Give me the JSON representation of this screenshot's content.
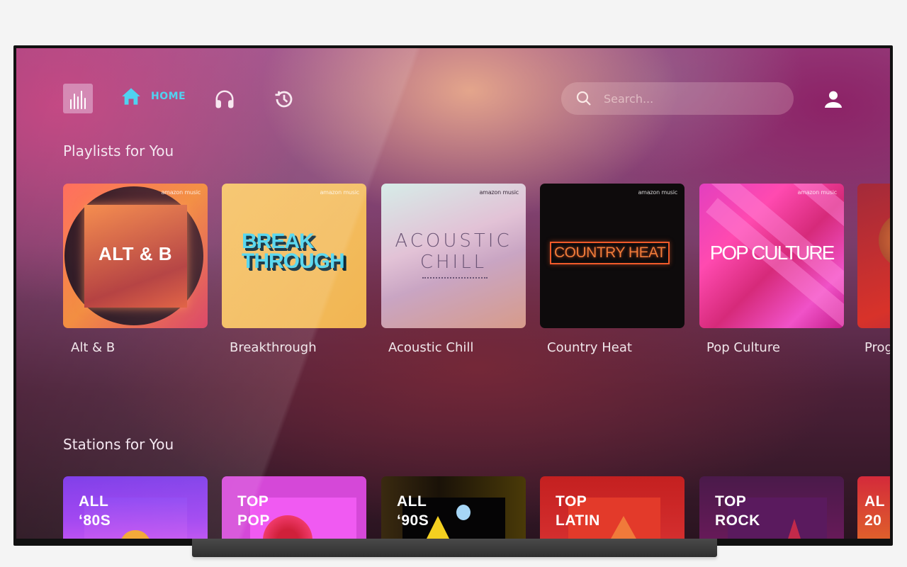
{
  "app": {
    "name": "Amazon Music",
    "brand_mark": "amazon music"
  },
  "nav": {
    "logo_icon": "equalizer-logo-icon",
    "items": [
      {
        "id": "home",
        "label": "HOME",
        "icon": "home-icon",
        "active": true
      },
      {
        "id": "library",
        "label": "",
        "icon": "headphones-icon",
        "active": false
      },
      {
        "id": "recent",
        "label": "",
        "icon": "history-clock-icon",
        "active": false
      }
    ],
    "search": {
      "placeholder": "Search...",
      "value": "",
      "icon": "search-icon"
    },
    "profile_icon": "user-icon"
  },
  "colors": {
    "accent": "#49d0ef",
    "text": "#f0e6ea"
  },
  "playlists": {
    "title": "Playlists for You",
    "items": [
      {
        "label": "Alt & B",
        "art_text": "ALT & B"
      },
      {
        "label": "Breakthrough",
        "art_text": "BREAK THROUGH"
      },
      {
        "label": "Acoustic Chill",
        "art_text": "ACOUSTIC CHILL"
      },
      {
        "label": "Country Heat",
        "art_text": "COUNTRY HEAT"
      },
      {
        "label": "Pop Culture",
        "art_text": "POP CULTURE"
      },
      {
        "label": "Prog",
        "art_text": ""
      }
    ]
  },
  "stations": {
    "title": "Stations for You",
    "items": [
      {
        "line1": "ALL",
        "line2": "‘80S"
      },
      {
        "line1": "TOP",
        "line2": "POP"
      },
      {
        "line1": "ALL",
        "line2": "‘90S"
      },
      {
        "line1": "TOP",
        "line2": "LATIN"
      },
      {
        "line1": "TOP",
        "line2": "ROCK"
      },
      {
        "line1": "AL",
        "line2": "20"
      }
    ]
  }
}
